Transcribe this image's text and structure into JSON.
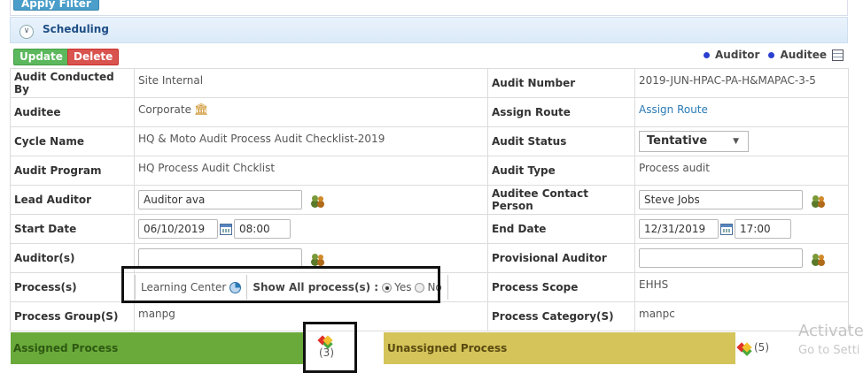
{
  "toolbar": {
    "apply_filter": "Apply Filter"
  },
  "section": {
    "title": "Scheduling"
  },
  "actions": {
    "update": "Update",
    "delete": "Delete"
  },
  "legend": {
    "auditor": "Auditor",
    "auditee": "Auditee"
  },
  "form": {
    "audit_conducted_by": {
      "label": "Audit Conducted By",
      "value": "Site Internal"
    },
    "audit_number": {
      "label": "Audit Number",
      "value": "2019-JUN-HPAC-PA-H&MAPAC-3-5"
    },
    "auditee": {
      "label": "Auditee",
      "value": "Corporate"
    },
    "assign_route": {
      "label": "Assign Route",
      "value": "Assign Route"
    },
    "cycle_name": {
      "label": "Cycle Name",
      "value": "HQ & Moto Audit Process Audit Checklist-2019"
    },
    "audit_status": {
      "label": "Audit Status",
      "value": "Tentative"
    },
    "audit_program": {
      "label": "Audit Program",
      "value": "HQ Process Audit Chcklist"
    },
    "audit_type": {
      "label": "Audit Type",
      "value": "Process audit"
    },
    "lead_auditor": {
      "label": "Lead Auditor",
      "value": "Auditor  ava"
    },
    "auditee_contact": {
      "label": "Auditee Contact Person",
      "value": "Steve Jobs"
    },
    "start_date": {
      "label": "Start Date",
      "date": "06/10/2019",
      "time": "08:00"
    },
    "end_date": {
      "label": "End Date",
      "date": "12/31/2019",
      "time": "17:00"
    },
    "auditors": {
      "label": "Auditor(s)",
      "value": ""
    },
    "provisional_auditor": {
      "label": "Provisional Auditor",
      "value": ""
    },
    "processes": {
      "label": "Process(s)",
      "learning_center": "Learning Center",
      "show_all_label": "Show All process(s) :",
      "yes": "Yes",
      "no": "No"
    },
    "process_scope": {
      "label": "Process Scope",
      "value": "EHHS"
    },
    "process_group": {
      "label": "Process Group(S)",
      "value": "manpg"
    },
    "process_category": {
      "label": "Process Category(S)",
      "value": "manpc"
    }
  },
  "bottom": {
    "assigned_label": "Assigned Process",
    "assigned_count": "(3)",
    "unassigned_label": "Unassigned Process",
    "unassigned_count": "(5)"
  },
  "watermark": {
    "line1": "Activate",
    "line2": "Go to Setti"
  }
}
